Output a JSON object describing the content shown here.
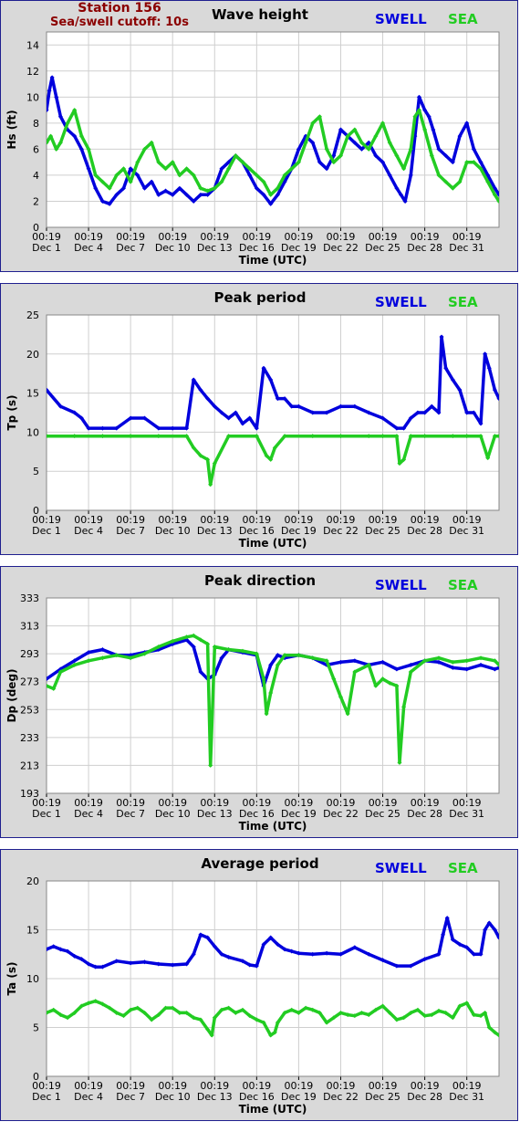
{
  "station": {
    "name": "Station 156",
    "cutoff": "Sea/swell cutoff: 10s"
  },
  "colors": {
    "swell": "#0000dd",
    "sea": "#22cc22",
    "panel_bg": "#d9d9d9",
    "plot_bg": "#ffffff",
    "border": "#1f1f8f",
    "station_text": "#8b0000"
  },
  "legend": {
    "swell": "SWELL",
    "sea": "SEA"
  },
  "x_axis": {
    "label": "Time (UTC)",
    "ticks": [
      {
        "time": "00:19",
        "date": "Dec 1"
      },
      {
        "time": "00:19",
        "date": "Dec 4"
      },
      {
        "time": "00:19",
        "date": "Dec 7"
      },
      {
        "time": "00:19",
        "date": "Dec 10"
      },
      {
        "time": "00:19",
        "date": "Dec 13"
      },
      {
        "time": "00:19",
        "date": "Dec 16"
      },
      {
        "time": "00:19",
        "date": "Dec 19"
      },
      {
        "time": "00:19",
        "date": "Dec 22"
      },
      {
        "time": "00:19",
        "date": "Dec 25"
      },
      {
        "time": "00:19",
        "date": "Dec 28"
      },
      {
        "time": "00:19",
        "date": "Dec 31"
      }
    ]
  },
  "chart_data": [
    {
      "type": "line",
      "title": "Wave height",
      "ylabel": "Hs (ft)",
      "ylim": [
        0,
        15
      ],
      "yticks": [
        0,
        2,
        4,
        6,
        8,
        10,
        12,
        14
      ],
      "x_unit": "days since Dec 1 00:19",
      "xlim": [
        0,
        32.3
      ],
      "grid": true,
      "series": [
        {
          "name": "SWELL",
          "x": [
            0,
            0.2,
            0.4,
            0.7,
            1,
            1.5,
            2,
            2.5,
            3,
            3.5,
            4,
            4.5,
            5,
            5.5,
            6,
            6.5,
            7,
            7.5,
            8,
            8.5,
            9,
            9.5,
            10,
            10.5,
            11,
            11.5,
            12,
            12.5,
            13,
            13.5,
            14,
            14.5,
            15,
            15.5,
            16,
            16.5,
            17,
            17.5,
            18,
            18.5,
            19,
            19.5,
            20,
            20.5,
            21,
            21.5,
            22,
            22.5,
            23,
            23.5,
            24,
            24.5,
            25,
            25.3,
            25.6,
            26,
            26.3,
            26.6,
            27,
            27.3,
            27.6,
            28,
            28.5,
            29,
            29.5,
            30,
            30.5,
            31,
            31.5,
            32,
            32.3
          ],
          "y": [
            9,
            10.5,
            11.5,
            10,
            8.5,
            7.5,
            7,
            6,
            4.5,
            3,
            2,
            1.8,
            2.5,
            3,
            4.5,
            4,
            3,
            3.5,
            2.5,
            2.8,
            2.5,
            3,
            2.5,
            2,
            2.5,
            2.5,
            3,
            4.5,
            5,
            5.5,
            5,
            4,
            3,
            2.5,
            1.8,
            2.5,
            3.5,
            4.5,
            6,
            7,
            6.5,
            5,
            4.5,
            5.5,
            7.5,
            7,
            6.5,
            6,
            6.5,
            5.5,
            5,
            4,
            3,
            2.5,
            2,
            4,
            7,
            10,
            9,
            8.5,
            7.5,
            6,
            5.5,
            5,
            7,
            8,
            6,
            5,
            4,
            3,
            2.5
          ]
        },
        {
          "name": "SEA",
          "x": [
            0,
            0.3,
            0.7,
            1,
            1.5,
            2,
            2.5,
            3,
            3.5,
            4,
            4.5,
            5,
            5.5,
            6,
            6.5,
            7,
            7.5,
            8,
            8.5,
            9,
            9.5,
            10,
            10.5,
            11,
            11.5,
            12,
            12.5,
            13,
            13.5,
            14,
            14.5,
            15,
            15.5,
            16,
            16.5,
            17,
            17.5,
            18,
            18.5,
            19,
            19.5,
            20,
            20.5,
            21,
            21.5,
            22,
            22.5,
            23,
            23.5,
            24,
            24.5,
            25,
            25.5,
            26,
            26.3,
            26.6,
            27,
            27.5,
            28,
            28.5,
            29,
            29.5,
            30,
            30.5,
            31,
            31.5,
            32,
            32.3
          ],
          "y": [
            6.5,
            7,
            6,
            6.5,
            8,
            9,
            7,
            6,
            4,
            3.5,
            3,
            4,
            4.5,
            3.5,
            5,
            6,
            6.5,
            5,
            4.5,
            5,
            4,
            4.5,
            4,
            3,
            2.8,
            3,
            3.5,
            4.5,
            5.5,
            5,
            4.5,
            4,
            3.5,
            2.5,
            3,
            4,
            4.5,
            5,
            6.5,
            8,
            8.5,
            6,
            5,
            5.5,
            7,
            7.5,
            6.5,
            6,
            7,
            8,
            6.5,
            5.5,
            4.5,
            6,
            8.5,
            9,
            7.5,
            5.5,
            4,
            3.5,
            3,
            3.5,
            5,
            5,
            4.5,
            3.5,
            2.5,
            2
          ]
        }
      ]
    },
    {
      "type": "scatter",
      "title": "Peak period",
      "ylabel": "Tp (s)",
      "ylim": [
        0,
        25
      ],
      "yticks": [
        0,
        5,
        10,
        15,
        20,
        25
      ],
      "x_unit": "days since Dec 1 00:19",
      "xlim": [
        0,
        32.3
      ],
      "grid": true,
      "series": [
        {
          "name": "SWELL",
          "x": [
            0,
            1,
            2,
            2.5,
            3,
            4,
            5,
            6,
            7,
            8,
            9,
            10,
            10.5,
            11,
            11.5,
            12,
            12.5,
            13,
            13.5,
            14,
            14.5,
            15,
            15.5,
            16,
            16.5,
            17,
            17.5,
            18,
            19,
            20,
            21,
            22,
            23,
            24,
            25,
            25.5,
            26,
            26.5,
            27,
            27.5,
            28,
            28.2,
            28.5,
            29,
            29.5,
            30,
            30.5,
            31,
            31.3,
            31.6,
            32,
            32.3
          ],
          "y": [
            15.4,
            13.3,
            12.5,
            11.8,
            10.5,
            10.5,
            10.5,
            11.8,
            11.8,
            10.5,
            10.5,
            10.5,
            16.7,
            15.4,
            14.3,
            13.3,
            12.5,
            11.8,
            12.5,
            11.1,
            11.8,
            10.5,
            18.2,
            16.7,
            14.3,
            14.3,
            13.3,
            13.3,
            12.5,
            12.5,
            13.3,
            13.3,
            12.5,
            11.8,
            10.5,
            10.5,
            11.8,
            12.5,
            12.5,
            13.3,
            12.5,
            22.2,
            18.2,
            16.7,
            15.4,
            12.5,
            12.5,
            11.1,
            20,
            18.2,
            15.4,
            14.3
          ]
        },
        {
          "name": "SEA",
          "x": [
            0,
            2,
            4,
            6,
            8,
            10,
            10.5,
            11,
            11.5,
            11.7,
            12,
            13,
            15,
            15.7,
            16,
            16.3,
            17,
            19,
            21,
            23,
            24,
            25,
            25.2,
            25.5,
            26,
            27,
            29,
            30,
            31,
            31.5,
            32,
            32.3
          ],
          "y": [
            9.5,
            9.5,
            9.5,
            9.5,
            9.5,
            9.5,
            8,
            7,
            6.5,
            3.3,
            6,
            9.5,
            9.5,
            7,
            6.5,
            8,
            9.5,
            9.5,
            9.5,
            9.5,
            9.5,
            9.5,
            6,
            6.5,
            9.5,
            9.5,
            9.5,
            9.5,
            9.5,
            6.7,
            9.5,
            9.5
          ]
        }
      ]
    },
    {
      "type": "scatter",
      "title": "Peak direction",
      "ylabel": "Dp (deg)",
      "ylim": [
        193,
        333
      ],
      "yticks": [
        193,
        213,
        233,
        253,
        273,
        293,
        313,
        333
      ],
      "x_unit": "days since Dec 1 00:19",
      "xlim": [
        0,
        32.3
      ],
      "grid": true,
      "series": [
        {
          "name": "SWELL",
          "x": [
            0,
            1,
            2,
            3,
            4,
            5,
            6,
            7,
            8,
            9,
            10,
            10.5,
            11,
            11.5,
            12,
            12.5,
            13,
            14,
            15,
            15.5,
            16,
            16.5,
            17,
            18,
            19,
            20,
            21,
            22,
            23,
            24,
            25,
            26,
            27,
            28,
            29,
            30,
            31,
            32,
            32.3
          ],
          "y": [
            275,
            282,
            288,
            294,
            296,
            292,
            292,
            294,
            296,
            300,
            303,
            298,
            280,
            275,
            278,
            290,
            296,
            294,
            292,
            270,
            285,
            292,
            290,
            292,
            290,
            285,
            287,
            288,
            285,
            287,
            282,
            285,
            288,
            287,
            283,
            282,
            285,
            282,
            283
          ]
        },
        {
          "name": "SEA",
          "x": [
            0,
            0.5,
            1,
            2,
            3,
            4,
            5,
            6,
            7,
            8,
            9,
            10,
            10.5,
            11,
            11.5,
            11.7,
            12,
            13,
            14,
            15,
            15.5,
            15.7,
            16,
            16.5,
            17,
            18,
            19,
            20,
            20.5,
            21,
            21.5,
            22,
            23,
            23.5,
            24,
            24.5,
            25,
            25.2,
            25.5,
            26,
            27,
            28,
            29,
            30,
            31,
            32,
            32.3
          ],
          "y": [
            270,
            268,
            280,
            285,
            288,
            290,
            292,
            290,
            293,
            298,
            302,
            305,
            306,
            303,
            300,
            213,
            298,
            296,
            295,
            293,
            275,
            250,
            265,
            285,
            292,
            292,
            290,
            288,
            275,
            262,
            250,
            280,
            285,
            270,
            275,
            272,
            270,
            215,
            255,
            280,
            288,
            290,
            287,
            288,
            290,
            288,
            285
          ]
        }
      ]
    },
    {
      "type": "scatter",
      "title": "Average period",
      "ylabel": "Ta (s)",
      "ylim": [
        0,
        20
      ],
      "yticks": [
        0,
        5,
        10,
        15,
        20
      ],
      "x_unit": "days since Dec 1 00:19",
      "xlim": [
        0,
        32.3
      ],
      "grid": true,
      "series": [
        {
          "name": "SWELL",
          "x": [
            0,
            0.5,
            1,
            1.5,
            2,
            2.5,
            3,
            3.5,
            4,
            5,
            6,
            7,
            8,
            9,
            10,
            10.5,
            11,
            11.5,
            12,
            12.5,
            13,
            14,
            14.5,
            15,
            15.5,
            16,
            16.5,
            17,
            17.5,
            18,
            19,
            20,
            21,
            22,
            23,
            24,
            25,
            26,
            27,
            28,
            28.3,
            28.6,
            29,
            29.5,
            30,
            30.5,
            31,
            31.3,
            31.6,
            32,
            32.3
          ],
          "y": [
            13,
            13.3,
            13,
            12.8,
            12.3,
            12,
            11.5,
            11.2,
            11.2,
            11.8,
            11.6,
            11.7,
            11.5,
            11.4,
            11.5,
            12.5,
            14.5,
            14.2,
            13.3,
            12.5,
            12.2,
            11.8,
            11.4,
            11.3,
            13.5,
            14.2,
            13.5,
            13,
            12.8,
            12.6,
            12.5,
            12.6,
            12.5,
            13.2,
            12.5,
            11.9,
            11.3,
            11.3,
            12,
            12.5,
            14.5,
            16.2,
            14,
            13.5,
            13.2,
            12.5,
            12.5,
            15,
            15.7,
            15,
            14.2
          ]
        },
        {
          "name": "SEA",
          "x": [
            0,
            0.5,
            1,
            1.5,
            2,
            2.5,
            3,
            3.5,
            4,
            4.5,
            5,
            5.5,
            6,
            6.5,
            7,
            7.5,
            8,
            8.5,
            9,
            9.5,
            10,
            10.5,
            11,
            11.5,
            11.8,
            12,
            12.5,
            13,
            13.5,
            14,
            14.5,
            15,
            15.5,
            16,
            16.3,
            16.5,
            17,
            17.5,
            18,
            18.5,
            19,
            19.5,
            20,
            20.5,
            21,
            21.5,
            22,
            22.5,
            23,
            23.5,
            24,
            24.5,
            25,
            25.5,
            26,
            26.5,
            27,
            27.5,
            28,
            28.5,
            29,
            29.5,
            30,
            30.5,
            31,
            31.3,
            31.6,
            32,
            32.3
          ],
          "y": [
            6.5,
            6.8,
            6.3,
            6,
            6.5,
            7.2,
            7.5,
            7.7,
            7.4,
            7,
            6.5,
            6.2,
            6.8,
            7,
            6.5,
            5.8,
            6.3,
            7,
            7,
            6.5,
            6.5,
            6,
            5.8,
            4.8,
            4.2,
            6,
            6.8,
            7,
            6.5,
            6.8,
            6.2,
            5.8,
            5.5,
            4.2,
            4.5,
            5.5,
            6.5,
            6.8,
            6.5,
            7,
            6.8,
            6.5,
            5.5,
            6,
            6.5,
            6.3,
            6.2,
            6.5,
            6.3,
            6.8,
            7.2,
            6.5,
            5.8,
            6,
            6.5,
            6.8,
            6.2,
            6.3,
            6.7,
            6.5,
            6,
            7.2,
            7.5,
            6.3,
            6.2,
            6.5,
            5,
            4.5,
            4.2
          ]
        }
      ]
    }
  ]
}
